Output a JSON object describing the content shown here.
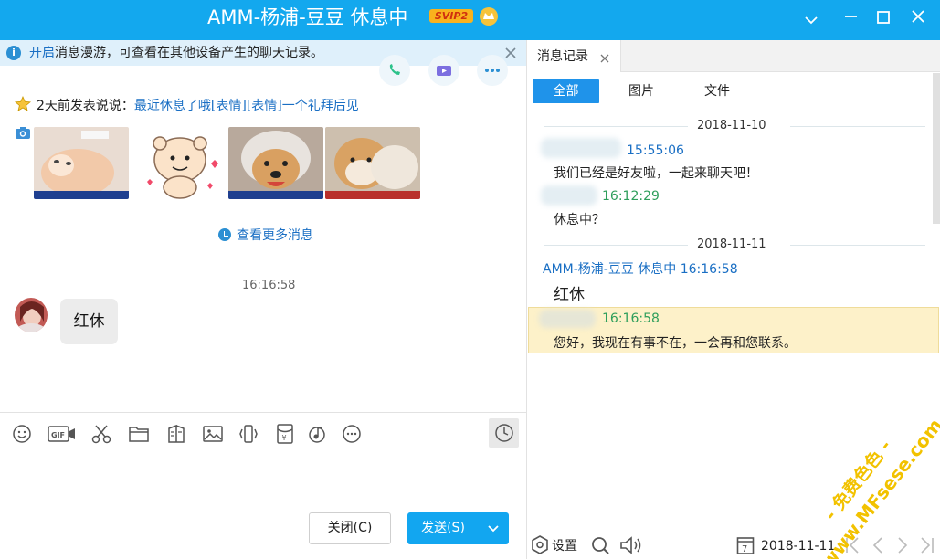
{
  "window": {
    "title": "AMM-杨浦-豆豆 休息中",
    "badge": "SVIP2",
    "controls": [
      "chevron-down-icon",
      "minimize-icon",
      "maximize-icon",
      "close-icon"
    ]
  },
  "banner": {
    "link": "开启",
    "text": "消息漫游，可查看在其他设备产生的聊天记录。"
  },
  "status": {
    "prefix": "2天前发表说说：",
    "post": "最近休息了哦[表情][表情]一个礼拜后见"
  },
  "chat": {
    "more_link": "查看更多消息",
    "time": "16:16:58",
    "message": "红休"
  },
  "toolbar": {
    "icons": [
      "emoji-icon",
      "gif-icon",
      "scissors-icon",
      "folder-icon",
      "doc-icon",
      "image-icon",
      "shake-icon",
      "red-packet-icon",
      "music-icon",
      "more-icon"
    ]
  },
  "actions": {
    "close": "关闭(C)",
    "send": "发送(S)"
  },
  "history": {
    "tab": "消息记录",
    "filters": [
      "全部",
      "图片",
      "文件"
    ],
    "entries": [
      {
        "date": "2018-11-10"
      },
      {
        "time": "15:55:06",
        "text": "我们已经是好友啦，一起来聊天吧！"
      },
      {
        "time": "16:12:29",
        "text": "休息中？"
      },
      {
        "date": "2018-11-11"
      },
      {
        "sender": "AMM-杨浦-豆豆 休息中 16:16:58",
        "text": "红休"
      },
      {
        "time": "16:16:58",
        "text": "您好，我现在有事不在，一会再和您联系。"
      }
    ],
    "bottom": {
      "settings": "设置",
      "date": "2018-11-11",
      "calendar_day": "7"
    }
  },
  "watermark": {
    "line1": "- 免费色色 -",
    "line2": "www.MFsese.com"
  },
  "colors": {
    "titlebar": "#13a8ee",
    "link": "#1a6fc4",
    "time_green": "#2e9e5b",
    "active_tab": "#1f93ea",
    "highlight": "#fdf1c9",
    "watermark": "#f2c200"
  }
}
